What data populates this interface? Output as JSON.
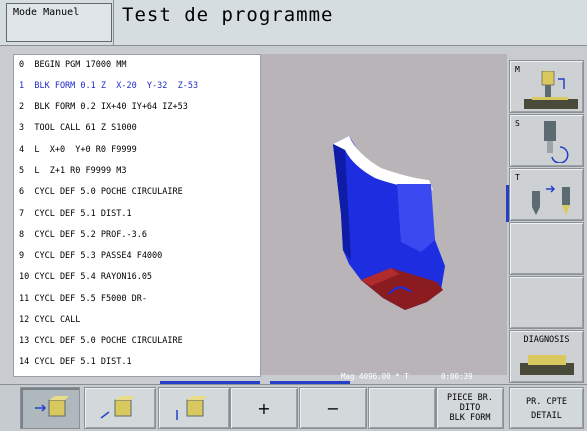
{
  "header": {
    "mode": "Mode Manuel",
    "title": "Test de programme"
  },
  "program": {
    "lines": [
      "0  BEGIN PGM 17000 MM",
      "1  BLK FORM 0.1 Z  X-20  Y-32  Z-53",
      "2  BLK FORM 0.2 IX+40 IY+64 IZ+53",
      "3  TOOL CALL 61 Z S1000",
      "4  L  X+0  Y+0 R0 F9999",
      "5  L  Z+1 R0 F9999 M3",
      "6  CYCL DEF 5.0 POCHE CIRCULAIRE",
      "7  CYCL DEF 5.1 DIST.1",
      "8  CYCL DEF 5.2 PROF.-3.6",
      "9  CYCL DEF 5.3 PASSE4 F4000",
      "10 CYCL DEF 5.4 RAYON16.05",
      "11 CYCL DEF 5.5 F5000 DR-",
      "12 CYCL CALL",
      "13 CYCL DEF 5.0 POCHE CIRCULAIRE",
      "14 CYCL DEF 5.1 DIST.1"
    ],
    "active_index": 1
  },
  "viewport": {
    "mag_label": "Mag 4096.00 * T",
    "time": "0:00:39"
  },
  "side": {
    "m_label": "M",
    "s_label": "S",
    "t_label": "T",
    "diagnosis_label": "DIAGNOSIS"
  },
  "softkeys": {
    "plus": "+",
    "minus": "−",
    "piece_line1": "PIECE BR.",
    "piece_line2": "DITO",
    "piece_line3": "BLK FORM",
    "detail_line1": "PR. CPTE",
    "detail_line2": "DETAIL"
  },
  "colors": {
    "active_line": "#1e2bc8",
    "part_blue": "#1d2ee0",
    "part_red": "#8a1c20"
  }
}
